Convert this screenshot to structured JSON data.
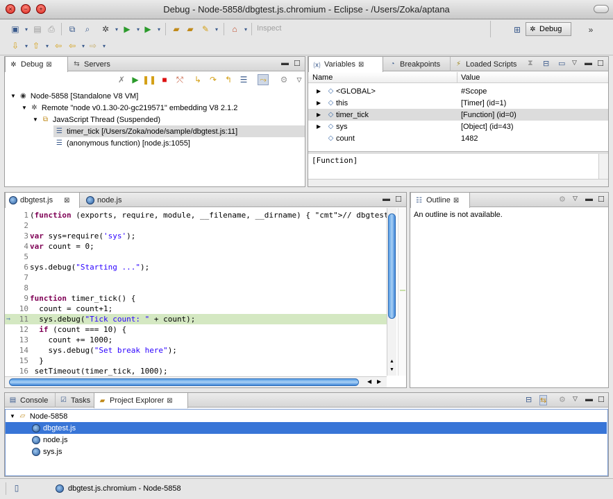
{
  "window": {
    "title": "Debug - Node-5858/dbgtest.js.chromium - Eclipse - /Users/Zoka/aptana"
  },
  "toolbar": {
    "inspect_label": "Inspect",
    "perspective_label": "Debug",
    "more_label": "»"
  },
  "debug_view": {
    "tabs": [
      {
        "label": "Debug",
        "icon": "bug-icon"
      },
      {
        "label": "Servers",
        "icon": "servers-icon"
      }
    ],
    "tree": [
      {
        "label": "Node-5858 [Standalone V8 VM]",
        "icon": "vm-icon"
      },
      {
        "label": "Remote \"node v0.1.30-20-gc219571\" embedding V8 2.1.2",
        "icon": "remote-icon"
      },
      {
        "label": "JavaScript Thread (Suspended)",
        "icon": "thread-icon"
      },
      {
        "label": "timer_tick [/Users/Zoka/node/sample/dbgtest.js:11]",
        "icon": "stack-frame-icon"
      },
      {
        "label": "(anonymous function) [node.js:1055]",
        "icon": "stack-frame-icon"
      }
    ]
  },
  "variables_view": {
    "tabs": [
      {
        "label": "Variables",
        "icon": "variables-icon"
      },
      {
        "label": "Breakpoints",
        "icon": "breakpoints-icon"
      },
      {
        "label": "Loaded Scripts",
        "icon": "scripts-icon"
      }
    ],
    "columns": [
      "Name",
      "Value"
    ],
    "rows": [
      {
        "name": "<GLOBAL>",
        "value": "#Scope"
      },
      {
        "name": "this",
        "value": "[Timer]  (id=1)"
      },
      {
        "name": "timer_tick",
        "value": "[Function]  (id=0)"
      },
      {
        "name": "sys",
        "value": "[Object]  (id=43)"
      },
      {
        "name": "count",
        "value": "1482"
      }
    ],
    "detail": "[Function]"
  },
  "editor": {
    "tabs": [
      {
        "label": "dbgtest.js"
      },
      {
        "label": "node.js"
      }
    ],
    "lines": [
      {
        "num": "1",
        "text": "(function (exports, require, module, __filename, __dirname) { // dbgtest.js"
      },
      {
        "num": "2",
        "text": ""
      },
      {
        "num": "3",
        "text": "var sys=require('sys');"
      },
      {
        "num": "4",
        "text": "var count = 0;"
      },
      {
        "num": "5",
        "text": ""
      },
      {
        "num": "6",
        "text": "sys.debug(\"Starting ...\");"
      },
      {
        "num": "7",
        "text": ""
      },
      {
        "num": "8",
        "text": ""
      },
      {
        "num": "9",
        "text": "function timer_tick() {"
      },
      {
        "num": "10",
        "text": "  count = count+1;"
      },
      {
        "num": "11",
        "text": "  sys.debug(\"Tick count: \" + count);"
      },
      {
        "num": "12",
        "text": "  if (count === 10) {"
      },
      {
        "num": "13",
        "text": "    count += 1000;"
      },
      {
        "num": "14",
        "text": "    sys.debug(\"Set break here\");"
      },
      {
        "num": "15",
        "text": "  }"
      },
      {
        "num": "16",
        "text": " setTimeout(timer_tick, 1000);"
      }
    ]
  },
  "outline_view": {
    "tab_label": "Outline",
    "message": "An outline is not available."
  },
  "bottom_view": {
    "tabs": [
      {
        "label": "Console",
        "icon": "console-icon"
      },
      {
        "label": "Tasks",
        "icon": "tasks-icon"
      },
      {
        "label": "Project Explorer",
        "icon": "project-explorer-icon"
      }
    ],
    "tree": [
      {
        "label": "Node-5858",
        "icon": "folder-icon"
      },
      {
        "label": "dbgtest.js",
        "icon": "script-file-icon"
      },
      {
        "label": "node.js",
        "icon": "script-file-icon"
      },
      {
        "label": "sys.js",
        "icon": "script-file-icon"
      }
    ]
  },
  "status": {
    "text": "dbgtest.js.chromium - Node-5858"
  },
  "colors": {
    "selection": "#3875d7",
    "current_line": "#d4e8c2",
    "keyword": "#7f0055",
    "string": "#2a00ff"
  }
}
